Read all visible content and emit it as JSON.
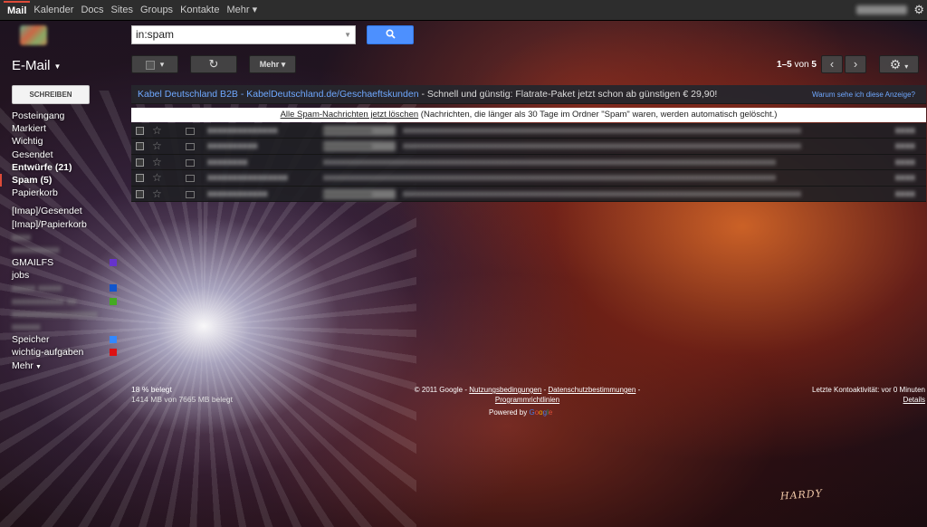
{
  "topnav": {
    "items": [
      "Mail",
      "Kalender",
      "Docs",
      "Sites",
      "Groups",
      "Kontakte",
      "Mehr ▾"
    ],
    "active": "Mail"
  },
  "search": {
    "value": "in:spam",
    "button_icon": "search-icon"
  },
  "header": {
    "title": "E-Mail",
    "more_label": "Mehr",
    "pager_range": "1–5",
    "pager_of": " von ",
    "pager_total": "5"
  },
  "sidebar": {
    "compose_label": "SCHREIBEN",
    "items": [
      {
        "label": "Posteingang"
      },
      {
        "label": "Markiert"
      },
      {
        "label": "Wichtig"
      },
      {
        "label": "Gesendet"
      },
      {
        "label": "Entwürfe (21)"
      },
      {
        "label": "Spam (5)"
      },
      {
        "label": "Papierkorb"
      },
      {
        "label": "[Imap]/Gesendet"
      },
      {
        "label": "[Imap]/Papierkorb"
      },
      {
        "label": "GMAILFS"
      },
      {
        "label": "jobs"
      },
      {
        "label": "Speicher"
      },
      {
        "label": "wichtig-aufgaben"
      },
      {
        "label": "Mehr"
      }
    ],
    "label_colors": {
      "gmailfs": "#6633cc",
      "blurred_a": "#1155cc",
      "blurred_b": "#44aa22",
      "speicher": "#3388ff",
      "wichtig_aufgaben": "#dd1111"
    }
  },
  "ad": {
    "link_text": "Kabel Deutschland B2B - KabelDeutschland.de/Geschaeftskunden",
    "text": " - Schnell und günstig: Flatrate-Paket jetzt schon ab günstigen € 29,90!",
    "why_text": "Warum sehe ich diese Anzeige?"
  },
  "notice": {
    "link_text": "Alle Spam-Nachrichten jetzt löschen",
    "text": " (Nachrichten, die länger als 30 Tage im Ordner \"Spam\" waren, werden automatisch gelöscht.)"
  },
  "footer": {
    "storage_percent": "18 % belegt",
    "storage_detail": "1414 MB von 7665 MB belegt",
    "copyright": "© 2011 Google - ",
    "terms": "Nutzungsbedingungen",
    "sep1": " - ",
    "privacy": "Datenschutzbestimmungen",
    "sep2": " -",
    "program": "Programmrichtlinien",
    "powered_by": "Powered by ",
    "activity": "Letzte Kontoaktivität: vor 0 Minuten",
    "details": "Details"
  },
  "colors": {
    "accent_red": "#dd4b39",
    "search_blue": "#4d90fe",
    "link_blue": "#6fa8ff"
  }
}
